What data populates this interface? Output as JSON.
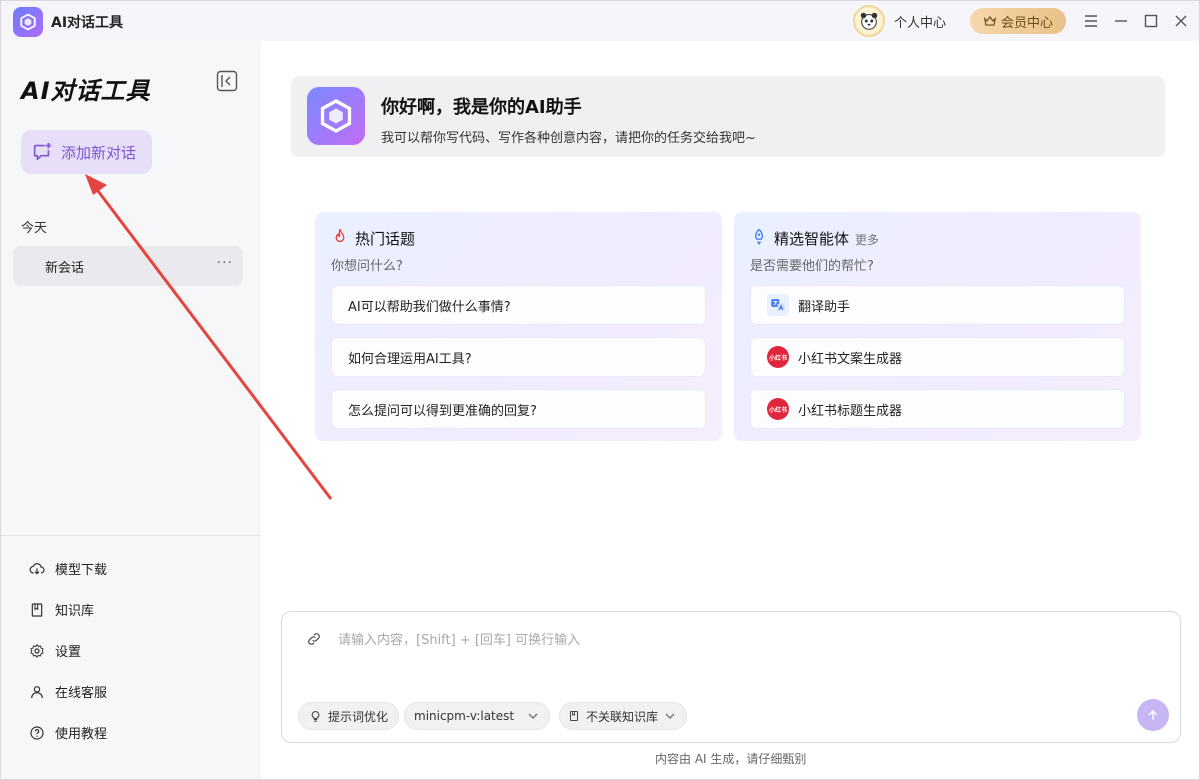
{
  "app": {
    "title": "AI对话工具"
  },
  "header": {
    "profile_label": "个人中心",
    "vip_label": "会员中心"
  },
  "sidebar": {
    "brand": "AI对话工具",
    "new_chat_label": "添加新对话",
    "section_today": "今天",
    "sessions": [
      {
        "label": "新会话",
        "more": "···"
      }
    ],
    "nav": [
      {
        "label": "模型下载",
        "icon": "cloud-download-icon"
      },
      {
        "label": "知识库",
        "icon": "book-icon"
      },
      {
        "label": "设置",
        "icon": "gear-icon"
      },
      {
        "label": "在线客服",
        "icon": "user-icon"
      },
      {
        "label": "使用教程",
        "icon": "help-icon"
      }
    ]
  },
  "hero": {
    "title": "你好啊，我是你的AI助手",
    "subtitle": "我可以帮你写代码、写作各种创意内容，请把你的任务交给我吧~"
  },
  "hot_topics": {
    "title": "热门话题",
    "subtitle": "你想问什么?",
    "items": [
      "AI可以帮助我们做什么事情?",
      "如何合理运用AI工具?",
      "怎么提问可以得到更准确的回复?"
    ]
  },
  "agents": {
    "title": "精选智能体",
    "more": "更多",
    "subtitle": "是否需要他们的帮忙?",
    "items": [
      {
        "label": "翻译助手",
        "icon": "translate-icon"
      },
      {
        "label": "小红书文案生成器",
        "icon": "xiaohongshu-icon",
        "badge": "小红书"
      },
      {
        "label": "小红书标题生成器",
        "icon": "xiaohongshu-icon",
        "badge": "小红书"
      }
    ]
  },
  "composer": {
    "placeholder": "请输入内容，[Shift] + [回车] 可换行输入",
    "prompt_optimize": "提示词优化",
    "model": "minicpm-v:latest",
    "knowledge": "不关联知识库"
  },
  "footer_note": "内容由 AI 生成，请仔细甄别",
  "colors": {
    "accent": "#7a55d6",
    "annotation": "#e5453e"
  }
}
